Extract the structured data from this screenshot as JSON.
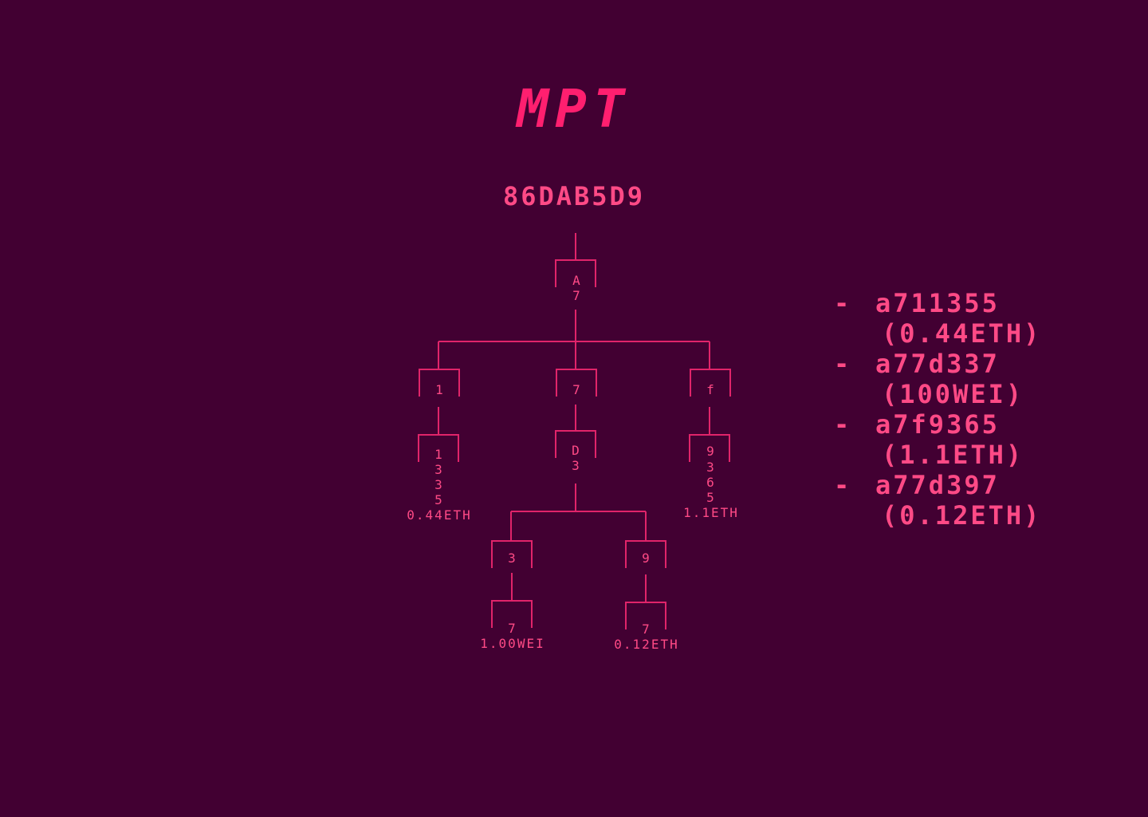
{
  "title": "MPT",
  "root_hash": "86DAB5D9",
  "tree": {
    "root": {
      "lines": [
        "A",
        "7"
      ]
    },
    "level1": [
      {
        "key": "1"
      },
      {
        "key": "7"
      },
      {
        "key": "f"
      }
    ],
    "leaf_1": {
      "lines": [
        "1",
        "3",
        "3",
        "5"
      ],
      "value": "0.44ETH"
    },
    "extension_7": {
      "lines": [
        "D",
        "3"
      ]
    },
    "leaf_f": {
      "lines": [
        "9",
        "3",
        "6",
        "5"
      ],
      "value": "1.1ETH"
    },
    "level3": [
      {
        "key": "3"
      },
      {
        "key": "9"
      }
    ],
    "leaf_3": {
      "lines": [
        "7"
      ],
      "value": "1.00WEI"
    },
    "leaf_9": {
      "lines": [
        "7"
      ],
      "value": "0.12ETH"
    }
  },
  "legend": [
    {
      "bullet": "-",
      "address": "a711355",
      "amount": "(0.44ETH)"
    },
    {
      "bullet": "-",
      "address": "a77d337",
      "amount": "(100WEI)"
    },
    {
      "bullet": "-",
      "address": "a7f9365",
      "amount": "(1.1ETH)"
    },
    {
      "bullet": "-",
      "address": "a77d397",
      "amount": "(0.12ETH)"
    }
  ]
}
